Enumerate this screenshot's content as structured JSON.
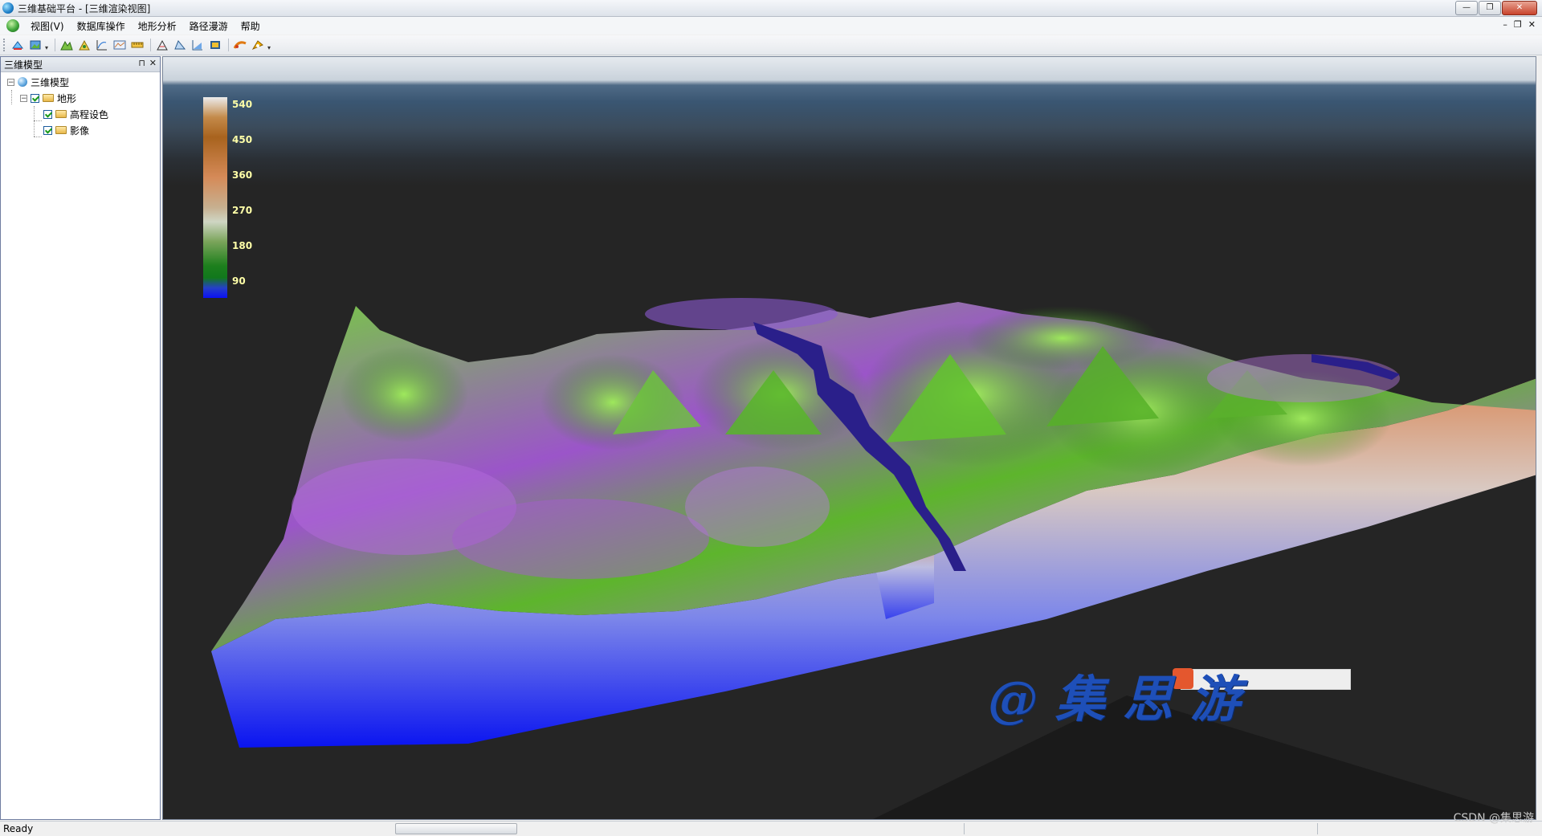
{
  "window": {
    "title": "三维基础平台 - [三维渲染视图]",
    "controls": {
      "minimize": "—",
      "restore": "❐",
      "close": "✕"
    }
  },
  "menubar": {
    "items": [
      "视图(V)",
      "数据库操作",
      "地形分析",
      "路径漫游",
      "帮助"
    ],
    "mdi": {
      "minimize": "–",
      "restore": "❐",
      "close": "✕"
    }
  },
  "toolbar": {
    "icons": [
      "layer-tools-icon",
      "terrain-import-icon",
      "slope-analysis-icon",
      "aspect-analysis-icon",
      "contour-icon",
      "profile-icon",
      "measure-icon",
      "cut-fill-icon",
      "visibility-icon",
      "volume-icon",
      "export-icon",
      "flight-path-icon",
      "camera-icon"
    ]
  },
  "panel": {
    "title": "三维模型",
    "pin": "⊓",
    "close": "✕",
    "tree": {
      "root": "三维模型",
      "group": "地形",
      "children": [
        {
          "label": "高程设色",
          "checked": true
        },
        {
          "label": "影像",
          "checked": true
        }
      ]
    }
  },
  "legend": {
    "labels": [
      "540",
      "450",
      "360",
      "270",
      "180",
      "90"
    ],
    "colors": [
      "#ececec",
      "#a8631e",
      "#d58a58",
      "#cfd6c4",
      "#1d7f1d",
      "#0a10f4"
    ]
  },
  "watermark": {
    "text": "@集思游",
    "csdn": "CSDN @集思游"
  },
  "status": {
    "text": "Ready"
  },
  "colors": {
    "terrain_green": "#5fbf2a",
    "terrain_purple": "#a25ad2",
    "river": "#2a1f8a",
    "wall_top": "#d78a5c",
    "wall_bottom": "#0a14f0",
    "background": "#252525"
  }
}
